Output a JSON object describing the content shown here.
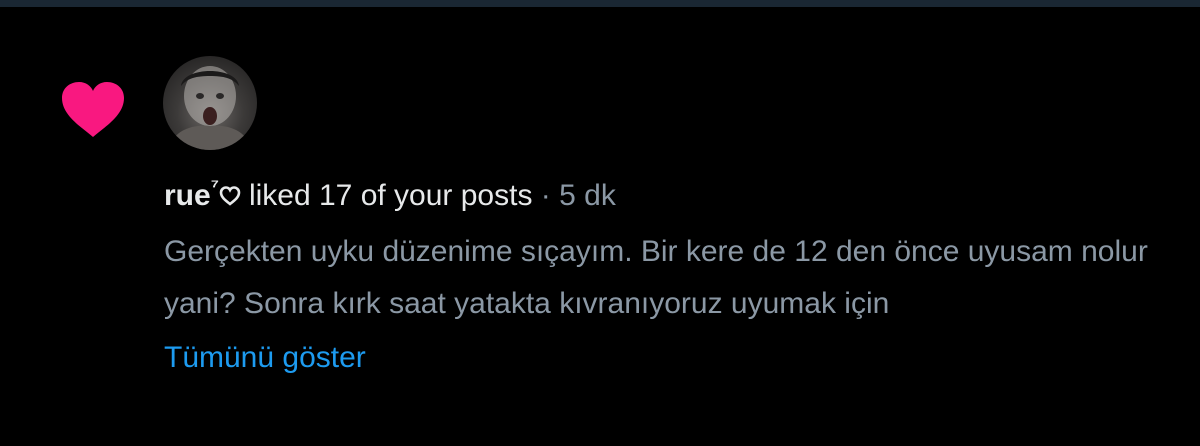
{
  "notification": {
    "type_icon": "heart-icon",
    "type_color": "#f91880",
    "user": {
      "name": "rue",
      "superscript": "⁷",
      "badge_icon": "heart-outline-icon",
      "avatar": "avatar"
    },
    "action_text": "liked 17 of your posts",
    "separator": "·",
    "time": "5 dk",
    "post_text": "Gerçekten uyku düzenime sıçayım. Bir kere de 12 den önce uyusam nolur yani? Sonra kırk saat yatakta kıvranıyoruz uyumak için",
    "show_more_label": "Tümünü göster",
    "link_color": "#1d9bf0"
  }
}
